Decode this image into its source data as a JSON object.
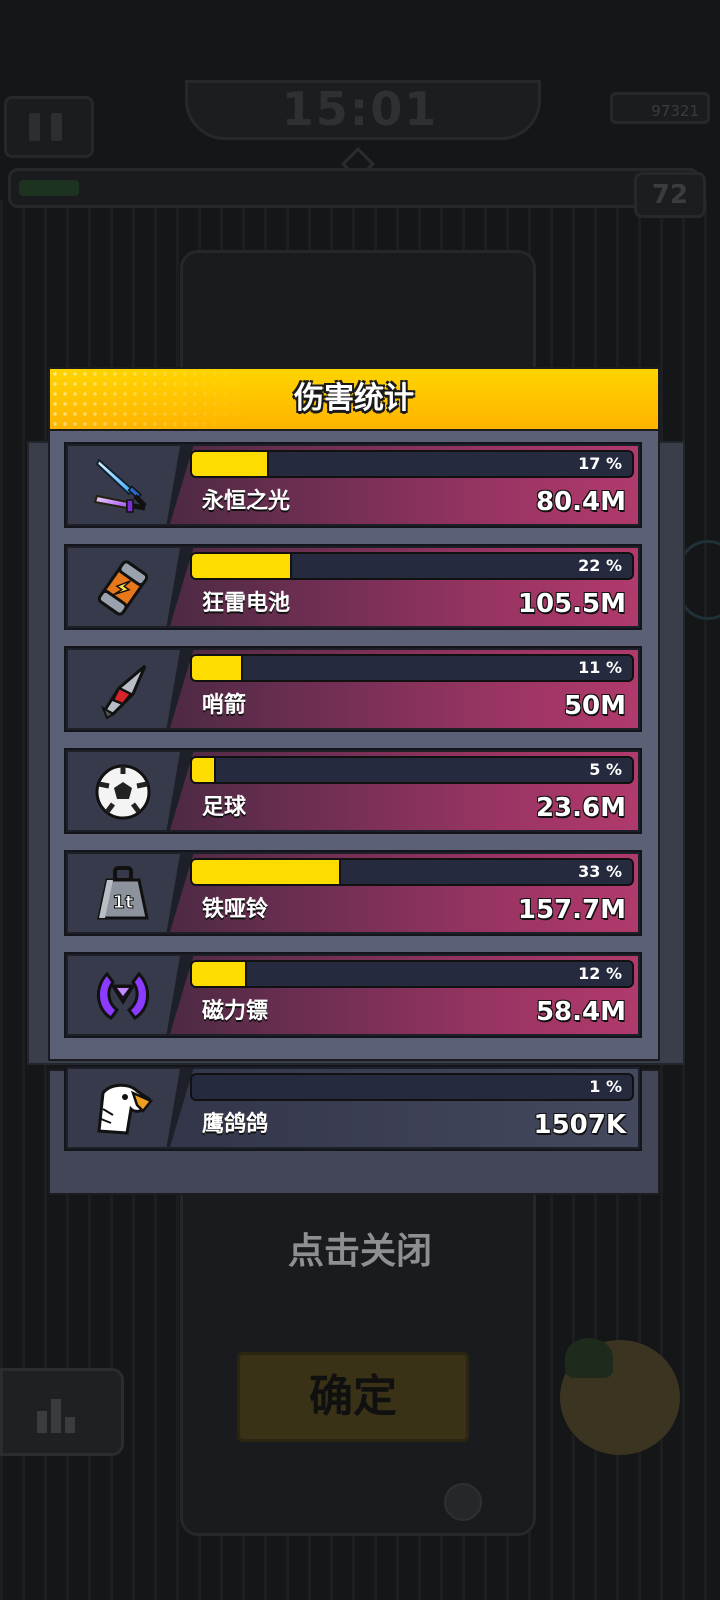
{
  "game_hud": {
    "timer": "15:01",
    "coins": "97321",
    "level": "72",
    "confirm_label": "确定"
  },
  "colors": {
    "header_yellow": "#ffd400",
    "bar_fill": "#ffdc00",
    "row_magenta": "#9a3463",
    "panel_slate": "#5b6076"
  },
  "modal": {
    "title": "伤害统计",
    "weapons": [
      {
        "name": "永恒之光",
        "percent_label": "17 %",
        "percent": 0.17,
        "damage": "80.4M",
        "icon": "twin-swords-icon"
      },
      {
        "name": "狂雷电池",
        "percent_label": "22 %",
        "percent": 0.22,
        "damage": "105.5M",
        "icon": "battery-icon"
      },
      {
        "name": "哨箭",
        "percent_label": "11 %",
        "percent": 0.11,
        "damage": "50M",
        "icon": "arrow-turret-icon"
      },
      {
        "name": "足球",
        "percent_label": "5 %",
        "percent": 0.05,
        "damage": "23.6M",
        "icon": "soccer-ball-icon"
      },
      {
        "name": "铁哑铃",
        "percent_label": "33 %",
        "percent": 0.33,
        "damage": "157.7M",
        "icon": "weight-1t-icon"
      },
      {
        "name": "磁力镖",
        "percent_label": "12 %",
        "percent": 0.12,
        "damage": "58.4M",
        "icon": "magnet-boomerang-icon"
      }
    ],
    "pet": {
      "name": "鹰鸽鸽",
      "percent_label": "1 %",
      "percent": 0.01,
      "damage": "1507K",
      "icon": "eagle-icon"
    },
    "close_hint": "点击关闭"
  }
}
